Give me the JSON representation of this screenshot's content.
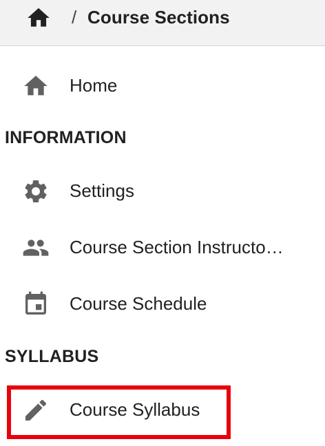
{
  "header": {
    "home_icon": "home-icon",
    "separator": "/",
    "title": "Course Sections"
  },
  "nav": {
    "home": {
      "label": "Home",
      "icon": "home-icon"
    },
    "sections": [
      {
        "title": "INFORMATION",
        "items": [
          {
            "label": "Settings",
            "icon": "gear-icon"
          },
          {
            "label": "Course Section Instructo…",
            "icon": "people-icon"
          },
          {
            "label": "Course Schedule",
            "icon": "calendar-icon"
          }
        ]
      },
      {
        "title": "SYLLABUS",
        "items": [
          {
            "label": "Course Syllabus",
            "icon": "pencil-icon",
            "highlighted": true
          }
        ]
      }
    ]
  },
  "colors": {
    "icon": "#616161",
    "highlight_border": "#e8000b",
    "header_bg": "#f2f2f2"
  }
}
